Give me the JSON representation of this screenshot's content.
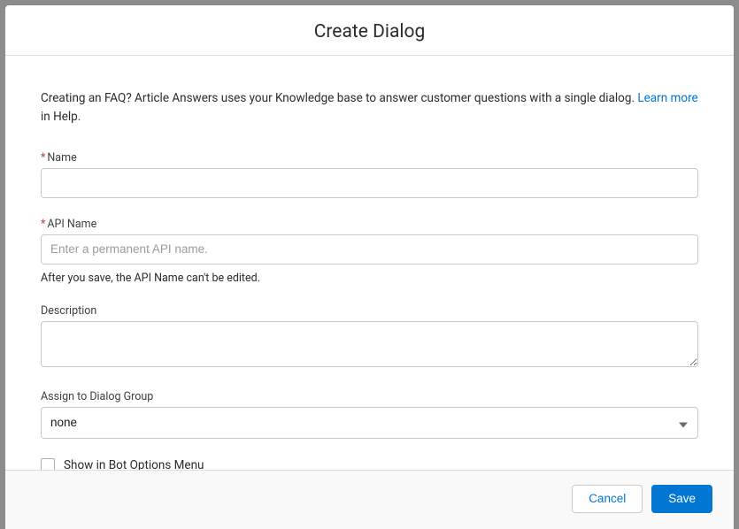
{
  "header": {
    "title": "Create Dialog"
  },
  "intro": {
    "before_link": "Creating an FAQ? Article Answers uses your Knowledge base to answer customer questions with a single dialog. ",
    "link_text": "Learn more",
    "after_link": " in Help."
  },
  "form": {
    "required_marker": "*",
    "name": {
      "label": "Name",
      "value": ""
    },
    "api_name": {
      "label": "API Name",
      "placeholder": "Enter a permanent API name.",
      "value": "",
      "helper": "After you save, the API Name can't be edited."
    },
    "description": {
      "label": "Description",
      "value": ""
    },
    "dialog_group": {
      "label": "Assign to Dialog Group",
      "selected": "none"
    },
    "show_in_menu": {
      "label": "Show in Bot Options Menu",
      "checked": false
    }
  },
  "footer": {
    "cancel": "Cancel",
    "save": "Save"
  }
}
